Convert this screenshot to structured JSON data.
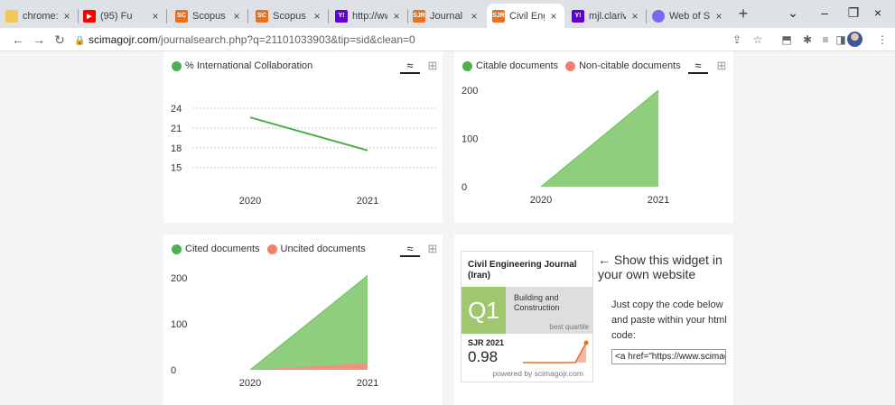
{
  "browser": {
    "tabs": [
      {
        "label": "chrome://",
        "close": "×",
        "icon": "chrome-tab-icon",
        "color": "#f5c65b"
      },
      {
        "label": "(95) Fu",
        "close": "×",
        "icon": "youtube-icon",
        "color": "#ff0000"
      },
      {
        "label": "Scopus pr",
        "close": "×",
        "icon": "scopus-icon",
        "color": "#e9711c"
      },
      {
        "label": "Scopus pr",
        "close": "×",
        "icon": "scopus-icon",
        "color": "#e9711c"
      },
      {
        "label": "http://ww",
        "close": "×",
        "icon": "yahoo-icon",
        "color": "#6001d2"
      },
      {
        "label": "Journal Ra",
        "close": "×",
        "icon": "sjr-icon",
        "color": "#e9711c"
      },
      {
        "label": "Civil Engin",
        "close": "×",
        "icon": "sjr-icon",
        "color": "#e9711c",
        "active": true
      },
      {
        "label": "mjl.clarivat",
        "close": "×",
        "icon": "yahoo-icon",
        "color": "#6001d2"
      },
      {
        "label": "Web of Sci",
        "close": "×",
        "icon": "web-of-science-icon",
        "color": "#7b68ee"
      }
    ],
    "tab_glyphs": {
      "sc": "SC",
      "y": "Y!",
      "sjr": "SJR",
      "yt": "▶"
    },
    "newtab_label": "+",
    "window_controls": {
      "chevron": "⌄",
      "minimize": "–",
      "restore": "❐",
      "close": "×"
    },
    "nav": {
      "back": "←",
      "forward": "→",
      "reload": "↻"
    },
    "url_host": "scimagojr.com",
    "url_path": "/journalsearch.php?q=21101033903&tip=sid&clean=0",
    "toolbar_icons": {
      "share": "⇪",
      "star": "☆",
      "extensions": "✱",
      "pinned": "⬒",
      "readinglist": "≡",
      "sidepanel": "◨",
      "menu": "⋮"
    }
  },
  "charts": {
    "chart_icon": "≈",
    "table_icon": "⊞",
    "international": {
      "legend": "% International Collaboration",
      "color": "#4caf50",
      "chart_data": {
        "type": "line",
        "x": [
          "2020",
          "2021"
        ],
        "series": [
          {
            "name": "% International Collaboration",
            "values": [
              22.6,
              17.6
            ]
          }
        ],
        "yticks": [
          "24",
          "21",
          "18",
          "15"
        ],
        "ylim": [
          14,
          25.5
        ]
      }
    },
    "citable": {
      "legend_a": "Citable documents",
      "legend_b": "Non-citable documents",
      "color_a": "#4caf50",
      "color_b": "#f08070",
      "chart_data": {
        "type": "area",
        "x": [
          "2020",
          "2021"
        ],
        "series": [
          {
            "name": "Citable documents",
            "values": [
              0,
              200
            ]
          },
          {
            "name": "Non-citable documents",
            "values": [
              0,
              0
            ]
          }
        ],
        "yticks": [
          "200",
          "100",
          "0"
        ],
        "ylim": [
          0,
          200
        ]
      }
    },
    "cited": {
      "legend_a": "Cited documents",
      "legend_b": "Uncited documents",
      "color_a": "#4caf50",
      "color_b": "#f08070",
      "chart_data": {
        "type": "area",
        "x": [
          "2020",
          "2021"
        ],
        "series": [
          {
            "name": "Cited documents",
            "values": [
              0,
              205
            ]
          },
          {
            "name": "Uncited documents",
            "values": [
              0,
              14
            ]
          }
        ],
        "yticks": [
          "200",
          "100",
          "0"
        ],
        "ylim": [
          0,
          210
        ]
      }
    }
  },
  "widget": {
    "title": "Civil Engineering Journal (Iran)",
    "quartile": "Q1",
    "category": "Building and Construction",
    "best_quartile": "best quartile",
    "sjr_label": "SJR 2021",
    "sjr_value": "0.98",
    "powered_by": "powered by scimagojr.com",
    "side_heading": "← Show this widget in your own website",
    "side_text": "Just copy the code below and paste within your html code:",
    "code": "<a href=\"https://www.scimag"
  }
}
